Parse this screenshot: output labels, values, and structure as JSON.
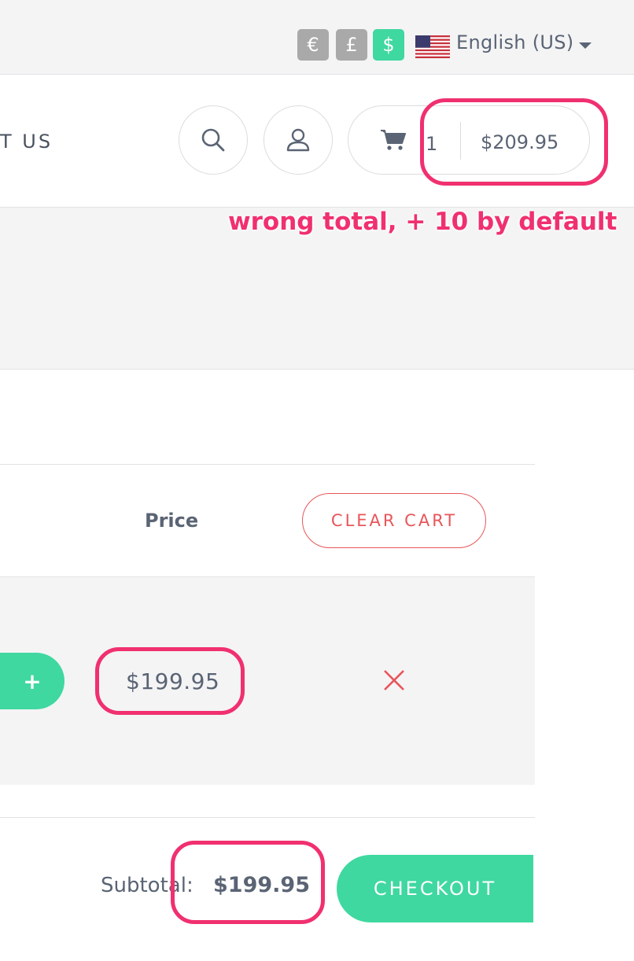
{
  "topbar": {
    "currencies": [
      {
        "symbol": "€",
        "active": false
      },
      {
        "symbol": "£",
        "active": false
      },
      {
        "symbol": "$",
        "active": true
      }
    ],
    "language": "English (US)",
    "flag_icon": "us-flag-icon"
  },
  "header": {
    "nav_partial": "T US",
    "cart": {
      "count": "1",
      "total": "$209.95"
    }
  },
  "table": {
    "price_header": "Price",
    "clear_label": "CLEAR CART",
    "row": {
      "price": "$199.95",
      "plus_label": "+",
      "remove_icon": "x-icon"
    }
  },
  "footer": {
    "subtotal_label": "Subtotal:",
    "subtotal_value": "$199.95",
    "checkout_label": "CHECKOUT"
  },
  "annotation": {
    "text": "wrong total, + 10 by default",
    "color": "#f0306f"
  },
  "colors": {
    "accent": "#3fd8a0",
    "danger": "#e8555a"
  }
}
